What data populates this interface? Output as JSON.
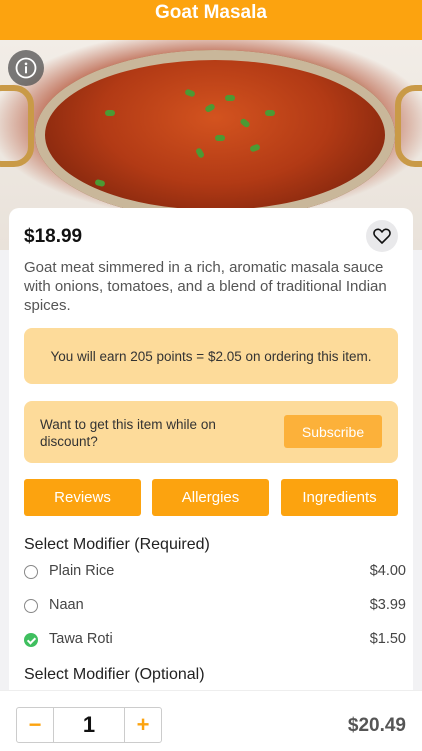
{
  "header": {
    "title": "Goat Masala"
  },
  "item": {
    "price": "$18.99",
    "description": "Goat meat simmered in a rich, aromatic masala sauce with onions, tomatoes, and a blend of traditional Indian spices."
  },
  "points_text": "You will earn 205 points = $2.05 on ordering this item.",
  "subscribe": {
    "text": "Want to get this item while on discount?",
    "button_label": "Subscribe"
  },
  "tabs": [
    {
      "label": "Reviews"
    },
    {
      "label": "Allergies"
    },
    {
      "label": "Ingredients"
    }
  ],
  "modifiers_required": {
    "title": "Select Modifier (Required)",
    "options": [
      {
        "name": "Plain Rice",
        "price": "$4.00",
        "selected": false
      },
      {
        "name": "Naan",
        "price": "$3.99",
        "selected": false
      },
      {
        "name": "Tawa Roti",
        "price": "$1.50",
        "selected": true
      }
    ]
  },
  "modifiers_optional": {
    "title": "Select Modifier (Optional)"
  },
  "cart": {
    "minus_label": "−",
    "quantity": "1",
    "plus_label": "+",
    "total": "$20.49"
  },
  "colors": {
    "brand": "#fca30f",
    "info_panel": "#fddb9a",
    "selected": "#3fbf5f"
  },
  "icons": {
    "info": "info-icon",
    "favorite": "heart-icon",
    "radio_unchecked": "radio-unchecked-icon",
    "radio_checked": "check-circle-icon"
  }
}
